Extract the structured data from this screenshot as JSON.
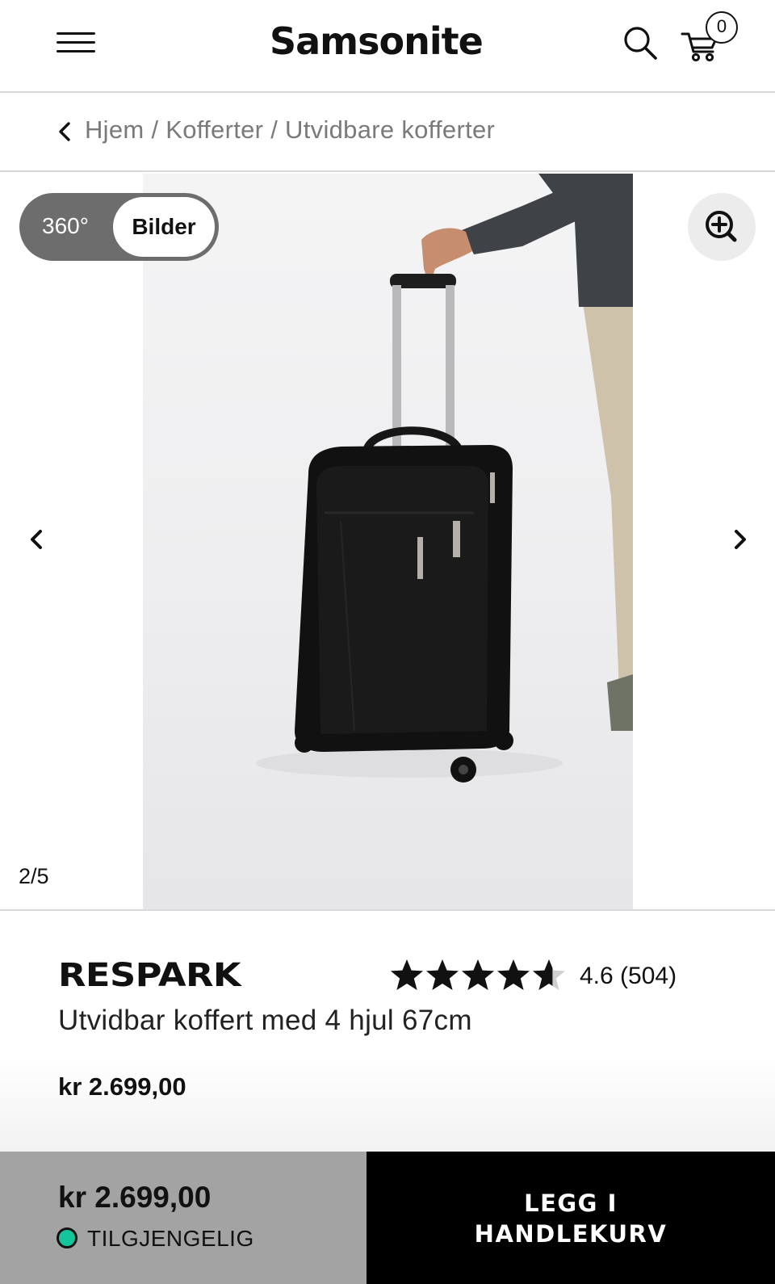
{
  "header": {
    "logo": "Samsonite",
    "cart_count": "0",
    "icons": [
      "hamburger-menu-icon",
      "search-icon",
      "cart-icon"
    ]
  },
  "breadcrumb": {
    "text": "Hjem / Kofferter / Utvidbare kofferter"
  },
  "gallery": {
    "toggle_360": "360°",
    "toggle_images": "Bilder",
    "counter": "2/5",
    "icons": [
      "zoom-in-icon",
      "chevron-left-icon",
      "chevron-right-icon"
    ]
  },
  "product": {
    "brand": "RESPARK",
    "subtitle": "Utvidbar koffert med 4 hjul 67cm",
    "price": "kr 2.699,00",
    "rating_text": "4.6 (504)",
    "rating_value": 4.6,
    "rating_max": 5
  },
  "sticky_bar": {
    "price": "kr 2.699,00",
    "status": "TILGJENGELIG",
    "add_to_cart": "LEGG I\nHANDLEKURV"
  },
  "colors": {
    "availability": "#14c49b",
    "bar_left": "#a3a3a3",
    "bar_right": "#000000"
  }
}
